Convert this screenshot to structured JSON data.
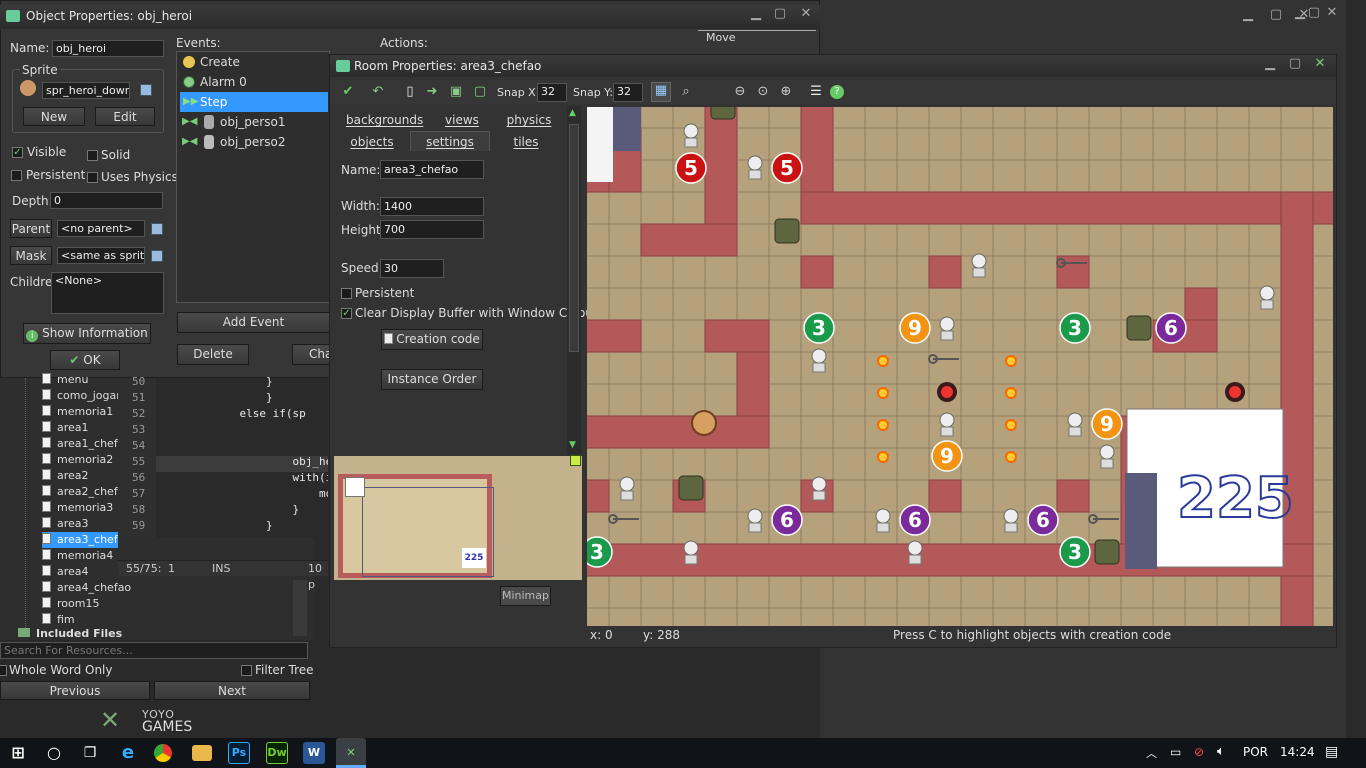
{
  "obj_window": {
    "title": "Object Properties: obj_heroi",
    "name_label": "Name:",
    "name_value": "obj_heroi",
    "sprite_group": "Sprite",
    "sprite_value": "spr_heroi_down",
    "new_label": "New",
    "edit_label": "Edit",
    "visible_label": "Visible",
    "solid_label": "Solid",
    "persistent_label": "Persistent",
    "uses_physics_label": "Uses Physics",
    "depth_label": "Depth:",
    "depth_value": "0",
    "parent_label": "Parent",
    "parent_value": "<no parent>",
    "mask_label": "Mask",
    "mask_value": "<same as sprite>",
    "children_label": "Children:",
    "children_value": "<None>",
    "show_info_label": "Show Information",
    "ok_label": "OK",
    "events_label": "Events:",
    "events": [
      "Create",
      "Alarm 0",
      "Step",
      "obj_perso1",
      "obj_perso2"
    ],
    "add_event_label": "Add Event",
    "delete_label": "Delete",
    "change_label": "Cha",
    "actions_label": "Actions:",
    "move_label": "Move"
  },
  "resource_tree": {
    "items": [
      "menu",
      "como_jogar",
      "memoria1",
      "area1",
      "area1_chef",
      "memoria2",
      "area2",
      "area2_chef",
      "memoria3",
      "area3",
      "area3_chef",
      "memoria4",
      "area4",
      "area4_chefao",
      "room15",
      "fim"
    ],
    "selected": "area3_chef",
    "included_files": "Included Files",
    "search_placeholder": "Search For Resources...",
    "whole_word_label": "Whole Word Only",
    "filter_tree_label": "Filter Tree",
    "previous_label": "Previous",
    "next_label": "Next",
    "brand_yoyo": "YOYO",
    "brand_games": "GAMES"
  },
  "code_editor": {
    "lines": [
      {
        "num": "50",
        "text": "                }"
      },
      {
        "num": "51",
        "text": "                }"
      },
      {
        "num": "52",
        "text": "            else if(sp"
      },
      {
        "num": "53",
        "text": ""
      },
      {
        "num": "54",
        "text": ""
      },
      {
        "num": "55",
        "text": "                    obj_he"
      },
      {
        "num": "56",
        "text": "                    with(i"
      },
      {
        "num": "57",
        "text": "                        mo"
      },
      {
        "num": "58",
        "text": "                    }"
      },
      {
        "num": "59",
        "text": "                }"
      }
    ],
    "status_pos": "55/75:",
    "status_col": "1",
    "status_mode": "INS",
    "status_pt": "10 p"
  },
  "room_window": {
    "title": "Room Properties: area3_chefao",
    "snap_x_label": "Snap X:",
    "snap_x": "32",
    "snap_y_label": "Snap Y:",
    "snap_y": "32",
    "tabs_row1": [
      "backgrounds",
      "views",
      "physics"
    ],
    "tabs_row2": [
      "objects",
      "settings",
      "tiles"
    ],
    "name_label": "Name:",
    "name_value": "area3_chefao",
    "width_label": "Width:",
    "width_value": "1400",
    "height_label": "Height:",
    "height_value": "700",
    "speed_label": "Speed:",
    "speed_value": "30",
    "persistent_label": "Persistent",
    "clear_buffer_label": "Clear Display Buffer with Window Colour",
    "creation_code_label": "Creation code",
    "instance_order_label": "Instance Order",
    "minimap_label": "Minimap",
    "minimap_number": "225",
    "status_x": "x: 0",
    "status_y": "y: 288",
    "status_hint": "Press C to highlight objects with creation code",
    "big_number": "225"
  },
  "taskbar": {
    "language": "POR",
    "time": "14:24"
  },
  "colors": {
    "grid_floor": "#b5a27c",
    "wall": "#b3595a",
    "panel": "#333333",
    "selection": "#3399ff"
  }
}
